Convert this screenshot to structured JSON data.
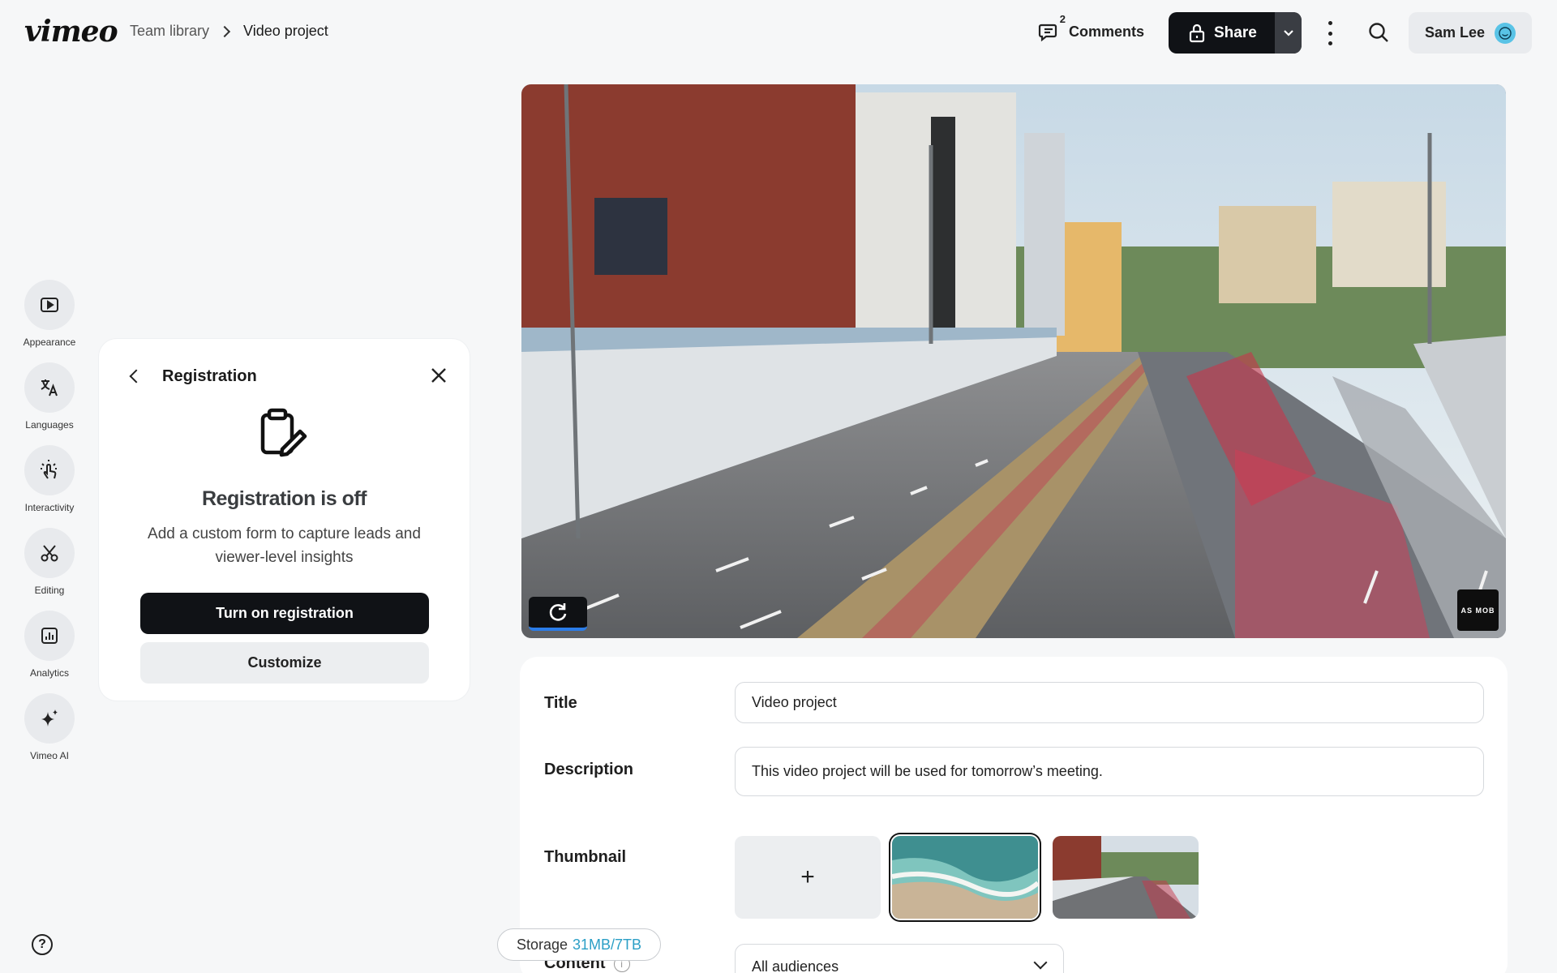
{
  "header": {
    "logo": "vimeo",
    "breadcrumb": [
      "Team library",
      "Video project"
    ],
    "comments_label": "Comments",
    "comments_count": "2",
    "share_label": "Share",
    "user_name": "Sam Lee"
  },
  "rail": {
    "items": [
      {
        "label": "Appearance",
        "icon": "play-box-icon"
      },
      {
        "label": "Languages",
        "icon": "translate-icon"
      },
      {
        "label": "Interactivity",
        "icon": "tap-icon"
      },
      {
        "label": "Editing",
        "icon": "scissors-icon"
      },
      {
        "label": "Analytics",
        "icon": "bar-chart-icon"
      },
      {
        "label": "Vimeo AI",
        "icon": "sparkle-icon"
      }
    ],
    "help": "?"
  },
  "registration": {
    "title": "Registration",
    "heading": "Registration is off",
    "description": "Add a custom form to capture leads and viewer-level insights",
    "primary_button": "Turn on registration",
    "secondary_button": "Customize"
  },
  "video": {
    "watermark": "AS MOB"
  },
  "details": {
    "title_label": "Title",
    "title_value": "Video project",
    "description_label": "Description",
    "description_value": "This video project will be used for tomorrow’s meeting.",
    "thumbnail_label": "Thumbnail",
    "thumbnail_add": "+",
    "content_label": "Content",
    "content_value": "All audiences"
  },
  "storage": {
    "label": "Storage",
    "value": "31MB/7TB"
  },
  "colors": {
    "accent": "#101216",
    "storage_value": "#2b9fc6",
    "avatar": "#59c3e6"
  }
}
